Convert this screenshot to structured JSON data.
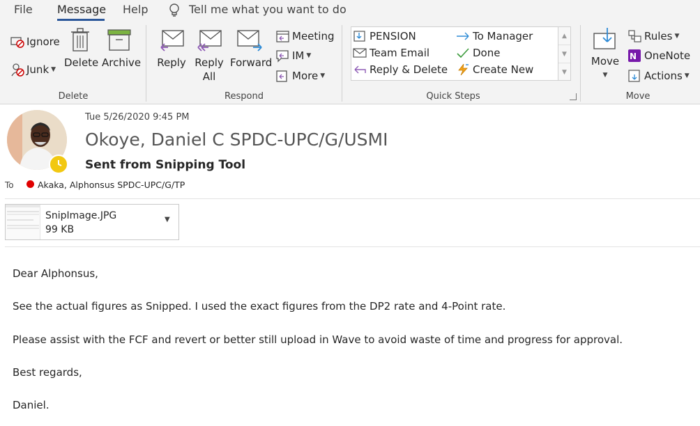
{
  "menu": {
    "file": "File",
    "message": "Message",
    "help": "Help",
    "tell_me": "Tell me what you want to do"
  },
  "ribbon": {
    "delete_group": {
      "label": "Delete",
      "ignore": "Ignore",
      "junk": "Junk",
      "delete": "Delete",
      "archive": "Archive"
    },
    "respond_group": {
      "label": "Respond",
      "reply": "Reply",
      "reply_all_line1": "Reply",
      "reply_all_line2": "All",
      "forward": "Forward",
      "meeting": "Meeting",
      "im": "IM",
      "more": "More"
    },
    "quick_steps_group": {
      "label": "Quick Steps",
      "items": [
        "PENSION",
        "To Manager",
        "Team Email",
        "Done",
        "Reply & Delete",
        "Create New"
      ]
    },
    "move_group": {
      "label": "Move",
      "move": "Move",
      "rules": "Rules",
      "onenote": "OneNote",
      "actions": "Actions"
    }
  },
  "message": {
    "date": "Tue 5/26/2020 9:45 PM",
    "sender": "Okoye, Daniel C SPDC-UPC/G/USMI",
    "subject": "Sent from Snipping Tool",
    "to_label": "To",
    "to_name": "Akaka, Alphonsus SPDC-UPC/G/TP",
    "attachment": {
      "name": "SnipImage.JPG",
      "size": "99 KB"
    },
    "body": [
      "Dear Alphonsus,",
      "See the actual figures as Snipped. I used the exact figures from the DP2 rate and 4-Point rate.",
      "Please assist with the FCF and revert or better still upload in Wave to avoid waste of time and progress for approval.",
      "Best regards,",
      "Daniel."
    ]
  },
  "colors": {
    "accent": "#2b579a",
    "ribbon_bg": "#f3f3f3",
    "presence_away": "#f2c811",
    "recipient_status": "#e00000",
    "onenote_purple": "#7719aa"
  }
}
